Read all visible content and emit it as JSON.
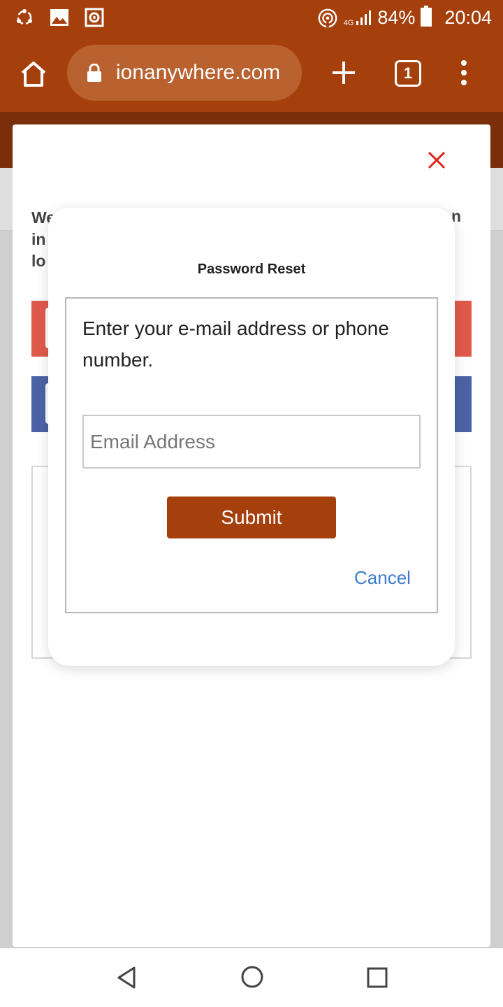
{
  "status_bar": {
    "network": "4G",
    "battery": "84%",
    "time": "20:04",
    "icons": [
      "sync-icon",
      "image-icon",
      "camera-icon",
      "hotspot-icon",
      "signal-icon",
      "battery-icon"
    ]
  },
  "browser": {
    "url": "ionanywhere.com",
    "tab_count": "1",
    "icons": [
      "home-icon",
      "lock-icon",
      "plus-icon",
      "tabs-icon",
      "menu-icon"
    ]
  },
  "login_modal": {
    "close_icon": "close-icon",
    "text_fragment_lines": [
      "We",
      "in",
      "lo"
    ],
    "text_fragment_right": "n",
    "colors": {
      "google": "#e05a4c",
      "facebook": "#4b63a6"
    }
  },
  "reset_dialog": {
    "title": "Password Reset",
    "instructions": "Enter your e-mail address or phone number.",
    "email_placeholder": "Email Address",
    "email_value": "",
    "submit_label": "Submit",
    "cancel_label": "Cancel",
    "colors": {
      "accent": "#a5400c",
      "link": "#3e7bd0"
    }
  },
  "nav_bar": {
    "icons": [
      "back-icon",
      "home-circle-icon",
      "recents-icon"
    ]
  }
}
